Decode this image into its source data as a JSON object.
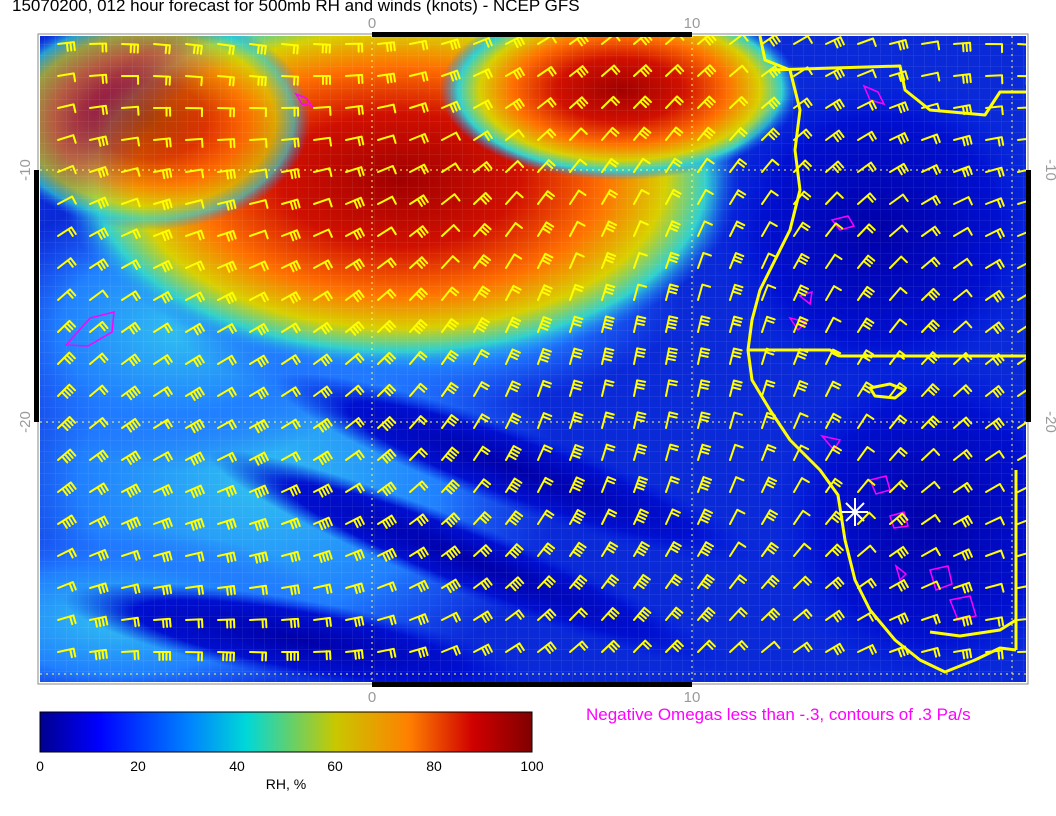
{
  "title": "15070200, 012 hour forecast for 500mb RH and winds (knots) - NCEP GFS",
  "axes": {
    "top_ticks": [
      "0",
      "10"
    ],
    "bottom_ticks": [
      "0",
      "10"
    ],
    "left_ticks": [
      "-10",
      "-20"
    ],
    "right_ticks": [
      "-10",
      "-20"
    ]
  },
  "omega_note": "Negative Omegas less than -.3, contours of .3 Pa/s",
  "colorbar": {
    "ticks": [
      "0",
      "20",
      "40",
      "60",
      "80",
      "100"
    ],
    "label": "RH, %",
    "colors": [
      "#00008f",
      "#0000ff",
      "#0080ff",
      "#00d8d8",
      "#c8c800",
      "#ff8000",
      "#d00000",
      "#800000"
    ]
  },
  "map": {
    "field": "500mb relative humidity",
    "barb_color": "#ffff00",
    "coast_color": "#ffff00",
    "omega_contour_color": "#ff00ff",
    "grid": "dotted yellow lat/lon lines",
    "location_marker": "white-star-icon"
  }
}
